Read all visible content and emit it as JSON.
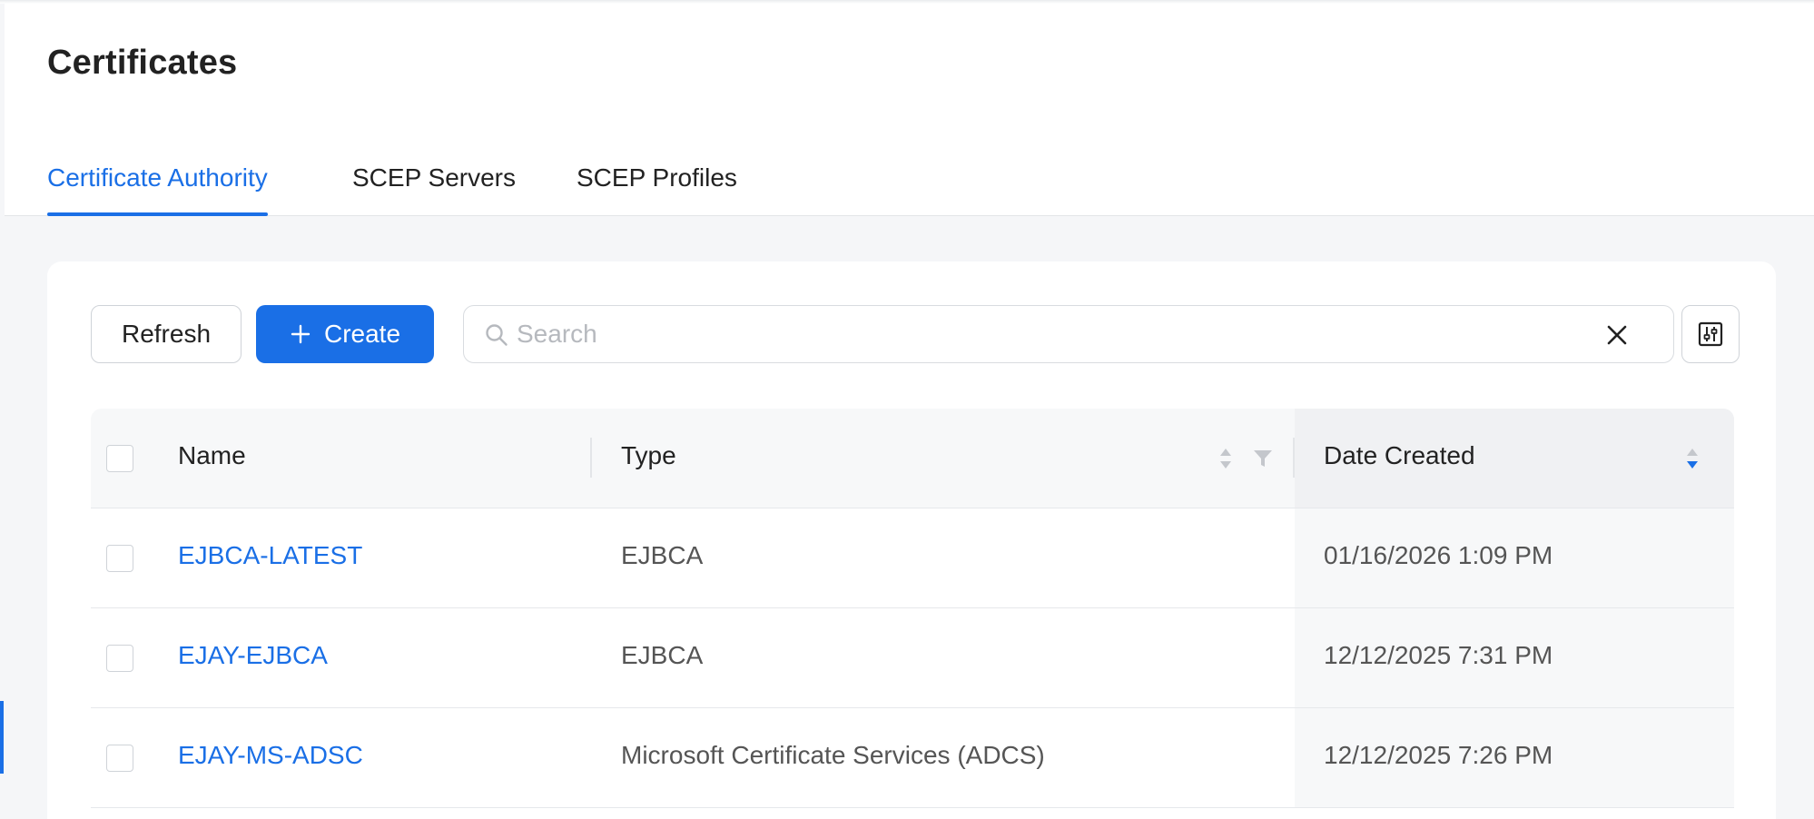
{
  "page": {
    "title": "Certificates"
  },
  "tabs": [
    {
      "label": "Certificate Authority",
      "active": true
    },
    {
      "label": "SCEP Servers",
      "active": false
    },
    {
      "label": "SCEP Profiles",
      "active": false
    }
  ],
  "toolbar": {
    "refresh_label": "Refresh",
    "create_label": "Create",
    "search_placeholder": "Search",
    "search_value": ""
  },
  "table": {
    "columns": {
      "name": "Name",
      "type": "Type",
      "date_created": "Date Created"
    },
    "sort": {
      "column": "date_created",
      "direction": "descending"
    },
    "rows": [
      {
        "name": "EJBCA-LATEST",
        "type": "EJBCA",
        "date_created": "01/16/2026 1:09 PM"
      },
      {
        "name": "EJAY-EJBCA",
        "type": "EJBCA",
        "date_created": "12/12/2025 7:31 PM"
      },
      {
        "name": "EJAY-MS-ADSC",
        "type": "Microsoft Certificate Services (ADCS)",
        "date_created": "12/12/2025 7:26 PM"
      }
    ]
  },
  "colors": {
    "accent": "#1a6fe6",
    "page_background": "#f5f6f8",
    "header_background": "#f7f8f9"
  },
  "icons": {
    "create": "plus-icon",
    "search": "search-icon",
    "clear": "close-icon",
    "settings": "column-settings-icon",
    "sort": "sort-icon",
    "filter": "filter-icon"
  }
}
